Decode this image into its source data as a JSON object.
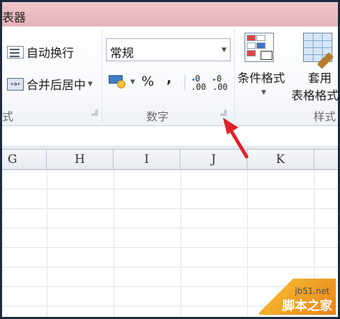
{
  "title": {
    "text": "表器"
  },
  "ribbon": {
    "alignment": {
      "wrap_text_label": "自动换行",
      "merge_center_label": "合并后居中",
      "merge_icon_text": "+a+",
      "group_label": "式"
    },
    "number": {
      "format_value": "常规",
      "percent_label": "%",
      "comma_label": ",",
      "increase_decimal_text": ".00",
      "decrease_decimal_text": ".00",
      "group_label": "数字"
    },
    "styles": {
      "conditional_format_label": "条件格式",
      "table_format_label_1": "套用",
      "table_format_label_2": "表格格式",
      "group_label": "样式"
    }
  },
  "grid": {
    "columns": [
      "G",
      "H",
      "I",
      "J",
      "K"
    ]
  },
  "watermark": {
    "url": "jb51.net",
    "brand": "脚本之家"
  },
  "colors": {
    "title_bar": "#e6b3b6",
    "frame": "#1b2b3f",
    "annotation_arrow": "#e0212a",
    "watermark_orange": "#e8841b"
  }
}
